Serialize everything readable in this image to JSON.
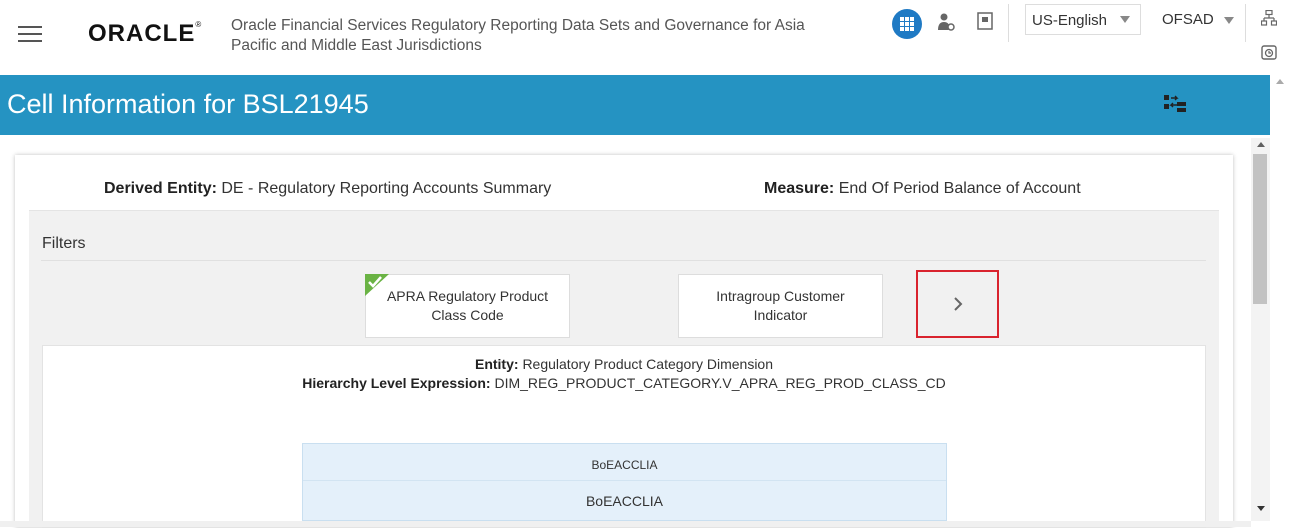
{
  "header": {
    "brand": "ORACLE",
    "app_title": "Oracle Financial Services Regulatory Reporting Data Sets and Governance for Asia Pacific and Middle East Jurisdictions",
    "language": "US-English",
    "user": "OFSAD",
    "accent_color": "#1f7ac4"
  },
  "page": {
    "title": "Cell Information for BSL21945",
    "band_color": "#2593c2"
  },
  "summary": {
    "derived_entity_label": "Derived Entity:",
    "derived_entity_value": "DE - Regulatory Reporting Accounts Summary",
    "measure_label": "Measure:",
    "measure_value": "End Of Period Balance of Account"
  },
  "filters": {
    "heading": "Filters",
    "cards": [
      {
        "label": "APRA Regulatory Product Class Code",
        "selected": true
      },
      {
        "label": "Intragroup Customer Indicator",
        "selected": false
      }
    ]
  },
  "detail": {
    "entity_label": "Entity:",
    "entity_value": "Regulatory Product Category Dimension",
    "hierarchy_label": "Hierarchy Level Expression:",
    "hierarchy_value": "DIM_REG_PRODUCT_CATEGORY.V_APRA_REG_PROD_CLASS_CD",
    "table_header": "BoEACCLIA",
    "table_value": "BoEACCLIA"
  }
}
